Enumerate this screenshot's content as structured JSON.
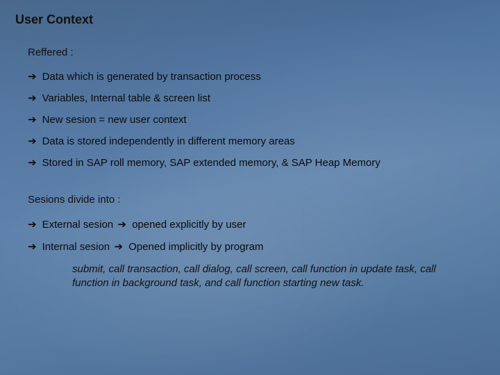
{
  "title": "User Context",
  "section1": {
    "heading": "Reffered :",
    "items": [
      "Data which is generated by transaction process",
      "Variables, Internal table & screen list",
      "New sesion = new user context",
      "Data is stored independently in different memory areas",
      "Stored in SAP roll memory, SAP extended memory, & SAP Heap Memory"
    ]
  },
  "section2": {
    "heading": "Sesions divide into :",
    "items": [
      {
        "left": "External sesion",
        "right": "opened explicitly by user"
      },
      {
        "left": "Internal sesion",
        "right": "Opened implicitly by program"
      }
    ]
  },
  "italic_note": "submit, call transaction, call dialog, call screen, call function in update task,  call function in background task, and call function starting new task.",
  "glyph": {
    "arrow": "➔"
  }
}
